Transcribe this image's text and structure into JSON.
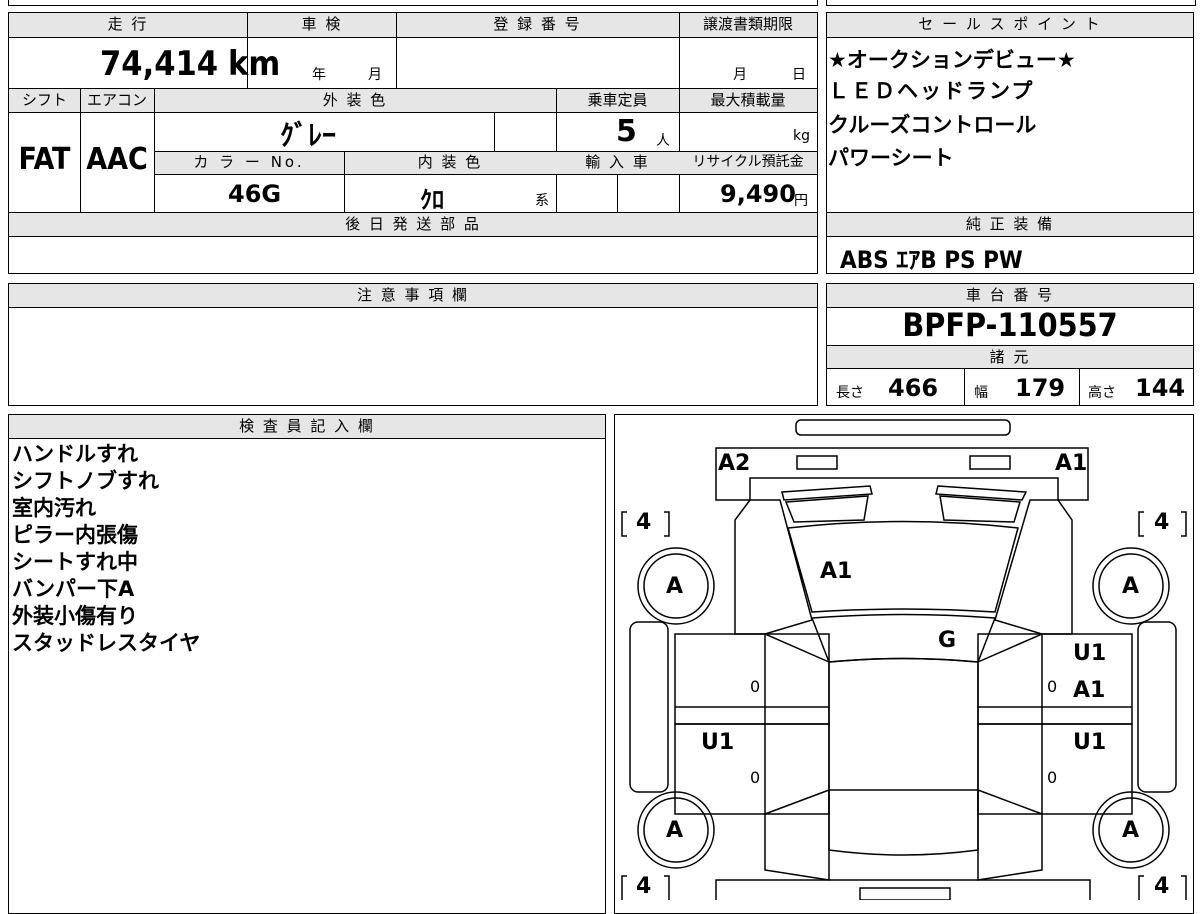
{
  "vehicle_info": {
    "mileage_header": "走 行",
    "mileage_value": "74,414",
    "mileage_unit": "km",
    "inspection_header": "車 検",
    "inspection_year_unit": "年",
    "inspection_month_unit": "月",
    "registration_header": "登 録 番 号",
    "transfer_deadline_header": "譲渡書類期限",
    "transfer_month_unit": "月",
    "transfer_day_unit": "日",
    "shift_header": "シフト",
    "shift_value": "FAT",
    "ac_header": "エアコン",
    "ac_value": "AAC",
    "exterior_color_header": "外 装 色",
    "exterior_color_value": "ｸﾞﾚｰ",
    "capacity_header": "乗車定員",
    "capacity_value": "5",
    "capacity_unit": "人",
    "max_load_header": "最大積載量",
    "max_load_unit": "kg",
    "color_no_header": "カ ラ ー No.",
    "color_no_value": "46G",
    "interior_color_header": "内 装 色",
    "interior_color_value": "ｸﾛ",
    "interior_color_suffix": "系",
    "import_header": "輸 入 車",
    "recycle_header": "リサイクル預託金",
    "recycle_value": "9,490",
    "recycle_unit": "円",
    "later_parts_header": "後 日 発 送 部 品"
  },
  "sales_points": {
    "header": "セ ー ル ス ポ イ ン ト",
    "items": [
      "★オークションデビュー★",
      "ＬＥＤヘッドランプ",
      "クルーズコントロール",
      "パワーシート"
    ]
  },
  "genuine_equipment": {
    "header": "純 正 装 備",
    "value": "ABS ｴｱB PS PW"
  },
  "notes": {
    "header": "注 意 事 項 欄"
  },
  "chassis": {
    "header": "車 台 番 号",
    "value": "BPFP-110557",
    "specs_header": "諸 元",
    "length_label": "長さ",
    "length_value": "466",
    "width_label": "幅",
    "width_value": "179",
    "height_label": "高さ",
    "height_value": "144"
  },
  "inspector": {
    "header": "検 査 員 記 入 欄",
    "items": [
      "ハンドルすれ",
      "シフトノブすれ",
      "室内汚れ",
      "ピラー内張傷",
      "シートすれ中",
      "バンパー下A",
      "外装小傷有り",
      "スタッドレスタイヤ"
    ]
  },
  "car_diagram": {
    "labels": {
      "front_left": "A2",
      "front_right": "A1",
      "hood": "A1",
      "windshield": "G",
      "right_front_door_1": "U1",
      "right_front_door_2": "A1",
      "left_rear_door": "U1",
      "right_rear_door": "U1",
      "tire_fl": "A",
      "tire_fr": "A",
      "tire_rl": "A",
      "tire_rr": "A",
      "tread_fl": "4",
      "tread_fr": "4",
      "tread_rl": "4",
      "tread_rr": "4",
      "zero_1": "0",
      "zero_2": "0",
      "zero_3": "0",
      "zero_4": "0"
    }
  }
}
